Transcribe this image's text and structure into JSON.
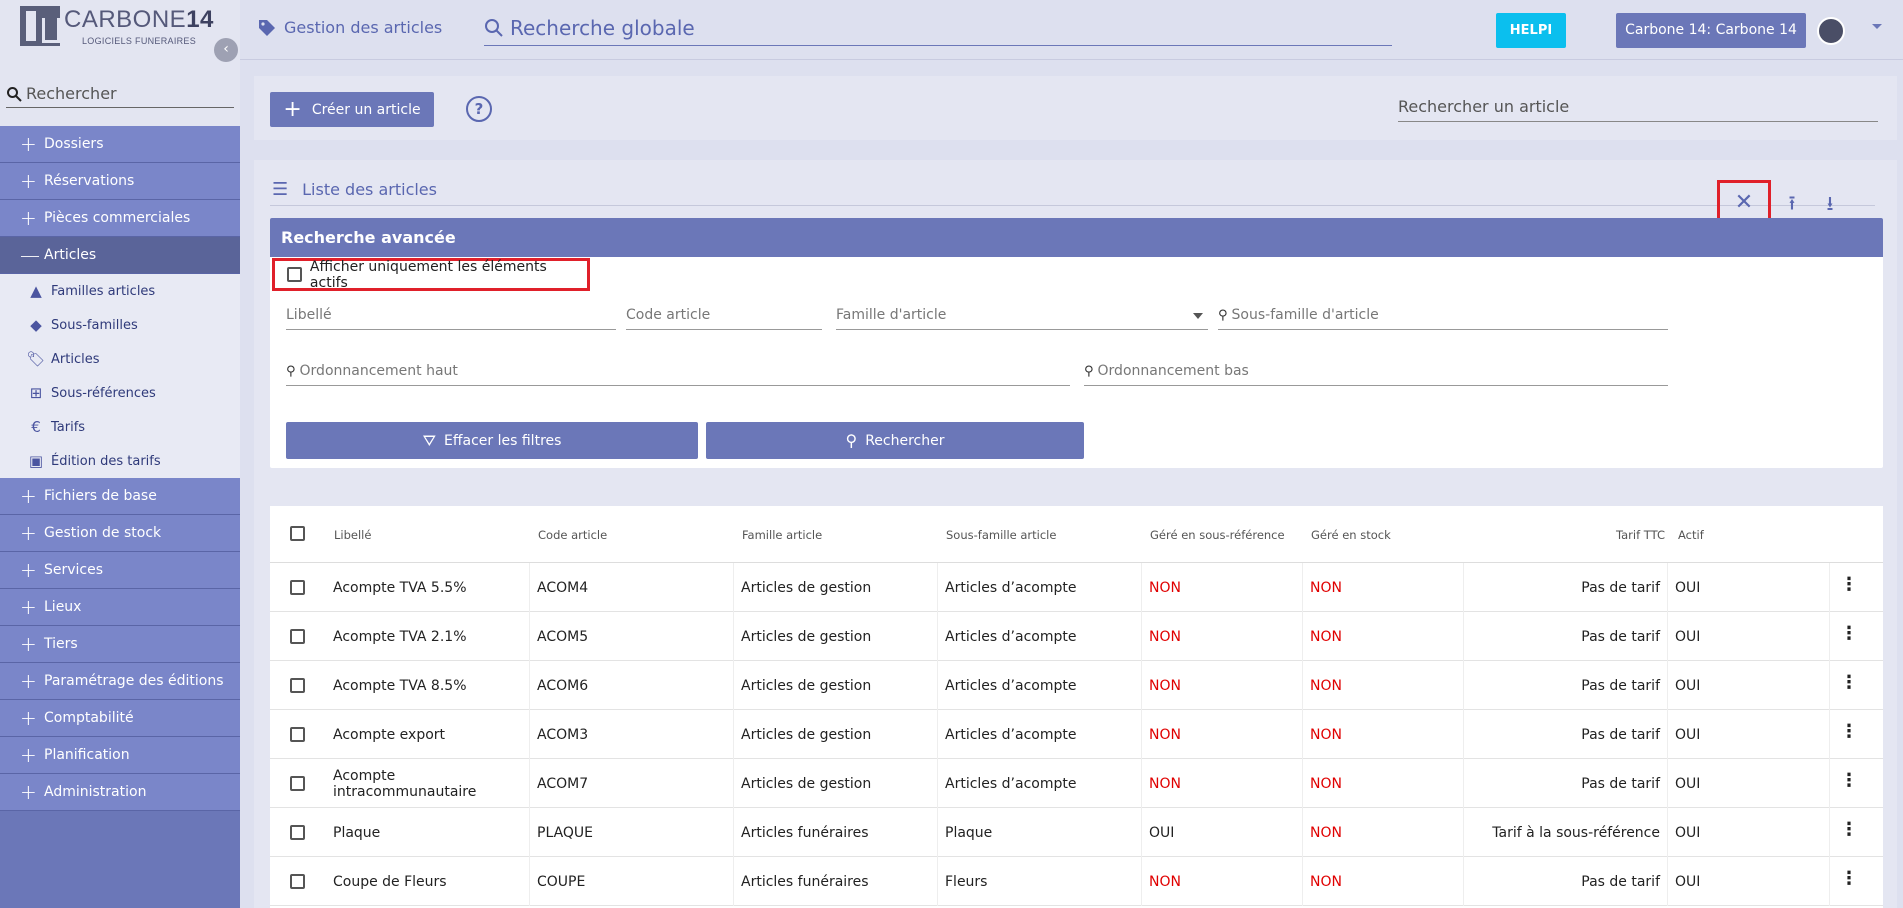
{
  "app": {
    "logo_text": "CARBONE",
    "logo_num": "14",
    "logo_sub": "LOGICIELS FUNERAIRES"
  },
  "sidebar": {
    "search_placeholder": "Rechercher",
    "items": [
      {
        "label": "Dossiers",
        "sign": "+"
      },
      {
        "label": "Réservations",
        "sign": "+"
      },
      {
        "label": "Pièces commerciales",
        "sign": "+"
      },
      {
        "label": "Articles",
        "sign": "—"
      }
    ],
    "subitems": [
      {
        "label": "Familles articles",
        "icon": "shapes-icon"
      },
      {
        "label": "Sous-familles",
        "icon": "shapes-icon"
      },
      {
        "label": "Articles",
        "icon": "tag-icon"
      },
      {
        "label": "Sous-références",
        "icon": "hierarchy-icon"
      },
      {
        "label": "Tarifs",
        "icon": "euro-icon"
      },
      {
        "label": "Édition des tarifs",
        "icon": "document-icon"
      }
    ],
    "items_after": [
      {
        "label": "Fichiers de base",
        "sign": "+"
      },
      {
        "label": "Gestion de stock",
        "sign": "+"
      },
      {
        "label": "Services",
        "sign": "+"
      },
      {
        "label": "Lieux",
        "sign": "+"
      },
      {
        "label": "Tiers",
        "sign": "+"
      },
      {
        "label": "Paramétrage des éditions",
        "sign": "+"
      },
      {
        "label": "Comptabilité",
        "sign": "+"
      },
      {
        "label": "Planification",
        "sign": "+"
      },
      {
        "label": "Administration",
        "sign": "+"
      }
    ]
  },
  "header": {
    "title": "Gestion des articles",
    "global_search": "Recherche globale",
    "helpi": "HELPI",
    "user": "Carbone 14: Carbone 14"
  },
  "toolbar": {
    "create_label": "Créer un article",
    "search_placeholder": "Rechercher un article"
  },
  "list": {
    "title": "Liste des articles"
  },
  "advanced": {
    "title": "Recherche avancée",
    "active_only": "Afficher uniquement les éléments actifs",
    "libelle": "Libellé",
    "code": "Code article",
    "famille": "Famille d'article",
    "sous_famille": "Sous-famille d'article",
    "ord_haut": "Ordonnancement haut",
    "ord_bas": "Ordonnancement bas",
    "clear_label": "Effacer les filtres",
    "search_label": "Rechercher"
  },
  "table": {
    "columns": [
      "Libellé",
      "Code article",
      "Famille article",
      "Sous-famille article",
      "Géré en sous-référence",
      "Géré en stock",
      "Tarif TTC",
      "Actif"
    ],
    "rows": [
      {
        "libelle": "Acompte TVA 5.5%",
        "code": "ACOM4",
        "famille": "Articles de gestion",
        "sous": "Articles d’acompte",
        "sousref": "NON",
        "stock": "NON",
        "tarif": "Pas de tarif",
        "actif": "OUI"
      },
      {
        "libelle": "Acompte TVA 2.1%",
        "code": "ACOM5",
        "famille": "Articles de gestion",
        "sous": "Articles d’acompte",
        "sousref": "NON",
        "stock": "NON",
        "tarif": "Pas de tarif",
        "actif": "OUI"
      },
      {
        "libelle": "Acompte TVA 8.5%",
        "code": "ACOM6",
        "famille": "Articles de gestion",
        "sous": "Articles d’acompte",
        "sousref": "NON",
        "stock": "NON",
        "tarif": "Pas de tarif",
        "actif": "OUI"
      },
      {
        "libelle": "Acompte export",
        "code": "ACOM3",
        "famille": "Articles de gestion",
        "sous": "Articles d’acompte",
        "sousref": "NON",
        "stock": "NON",
        "tarif": "Pas de tarif",
        "actif": "OUI"
      },
      {
        "libelle": "Acompte intracommunautaire",
        "code": "ACOM7",
        "famille": "Articles de gestion",
        "sous": "Articles d’acompte",
        "sousref": "NON",
        "stock": "NON",
        "tarif": "Pas de tarif",
        "actif": "OUI"
      },
      {
        "libelle": "Plaque",
        "code": "PLAQUE",
        "famille": "Articles funéraires",
        "sous": "Plaque",
        "sousref": "OUI",
        "stock": "NON",
        "tarif": "Tarif à la sous-référence",
        "actif": "OUI"
      },
      {
        "libelle": "Coupe de Fleurs",
        "code": "COUPE",
        "famille": "Articles funéraires",
        "sous": "Fleurs",
        "sousref": "NON",
        "stock": "NON",
        "tarif": "Pas de tarif",
        "actif": "OUI"
      }
    ]
  },
  "colors": {
    "accent": "#6b77b8",
    "helpi": "#0bbfee",
    "highlight": "#e0202a",
    "negative": "#e00000"
  }
}
